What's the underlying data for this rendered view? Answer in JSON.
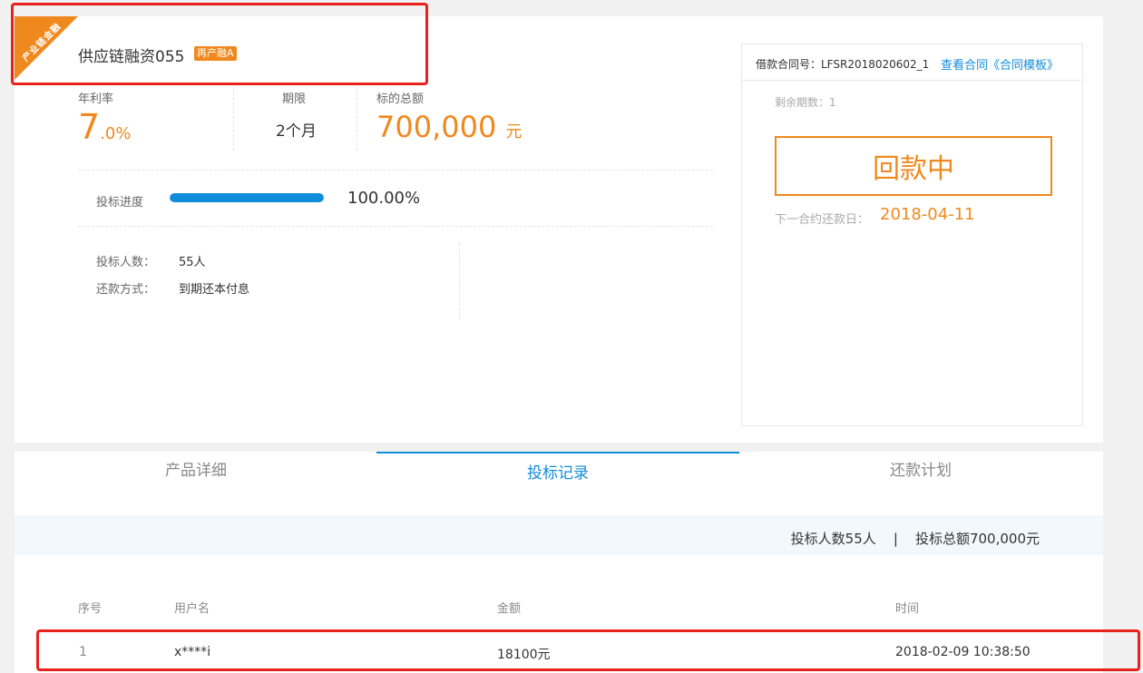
{
  "product": {
    "ribbon": "产业链金融",
    "title": "供应链融资055",
    "tag": "再产融A"
  },
  "stats": {
    "rate_label": "年利率",
    "rate_int": "7",
    "rate_dec": ".0%",
    "term_label": "期限",
    "term_value": "2个月",
    "total_label": "标的总额",
    "total_value": "700,000",
    "total_unit": "元"
  },
  "progress": {
    "label": "投标进度",
    "percent_text": "100.00%",
    "fraction": 1.0
  },
  "info": {
    "investors_label": "投标人数：",
    "investors_value": "55人",
    "repay_label": "还款方式：",
    "repay_value": "到期还本付息"
  },
  "card": {
    "contract_label": "借款合同号：LFSR2018020602_1",
    "view_link": "查看合同《合同模板》",
    "remaining": "剩余期数：1",
    "status": "回款中",
    "next_label": "下一合约还款日：",
    "next_date": "2018-04-11"
  },
  "tabs": [
    {
      "label": "产品详细",
      "active": false
    },
    {
      "label": "投标记录",
      "active": true
    },
    {
      "label": "还款计划",
      "active": false
    }
  ],
  "summary": "投标人数55人    |    投标总额700,000元",
  "table": {
    "headers": [
      "序号",
      "用户名",
      "金额",
      "时间"
    ],
    "rows": [
      [
        "1",
        "x****i",
        "18100元",
        "2018-02-09 10:38:50"
      ]
    ]
  },
  "colors": {
    "accent": "#f0891d",
    "link": "#0f8ddb",
    "annotation": "#e8211d"
  }
}
